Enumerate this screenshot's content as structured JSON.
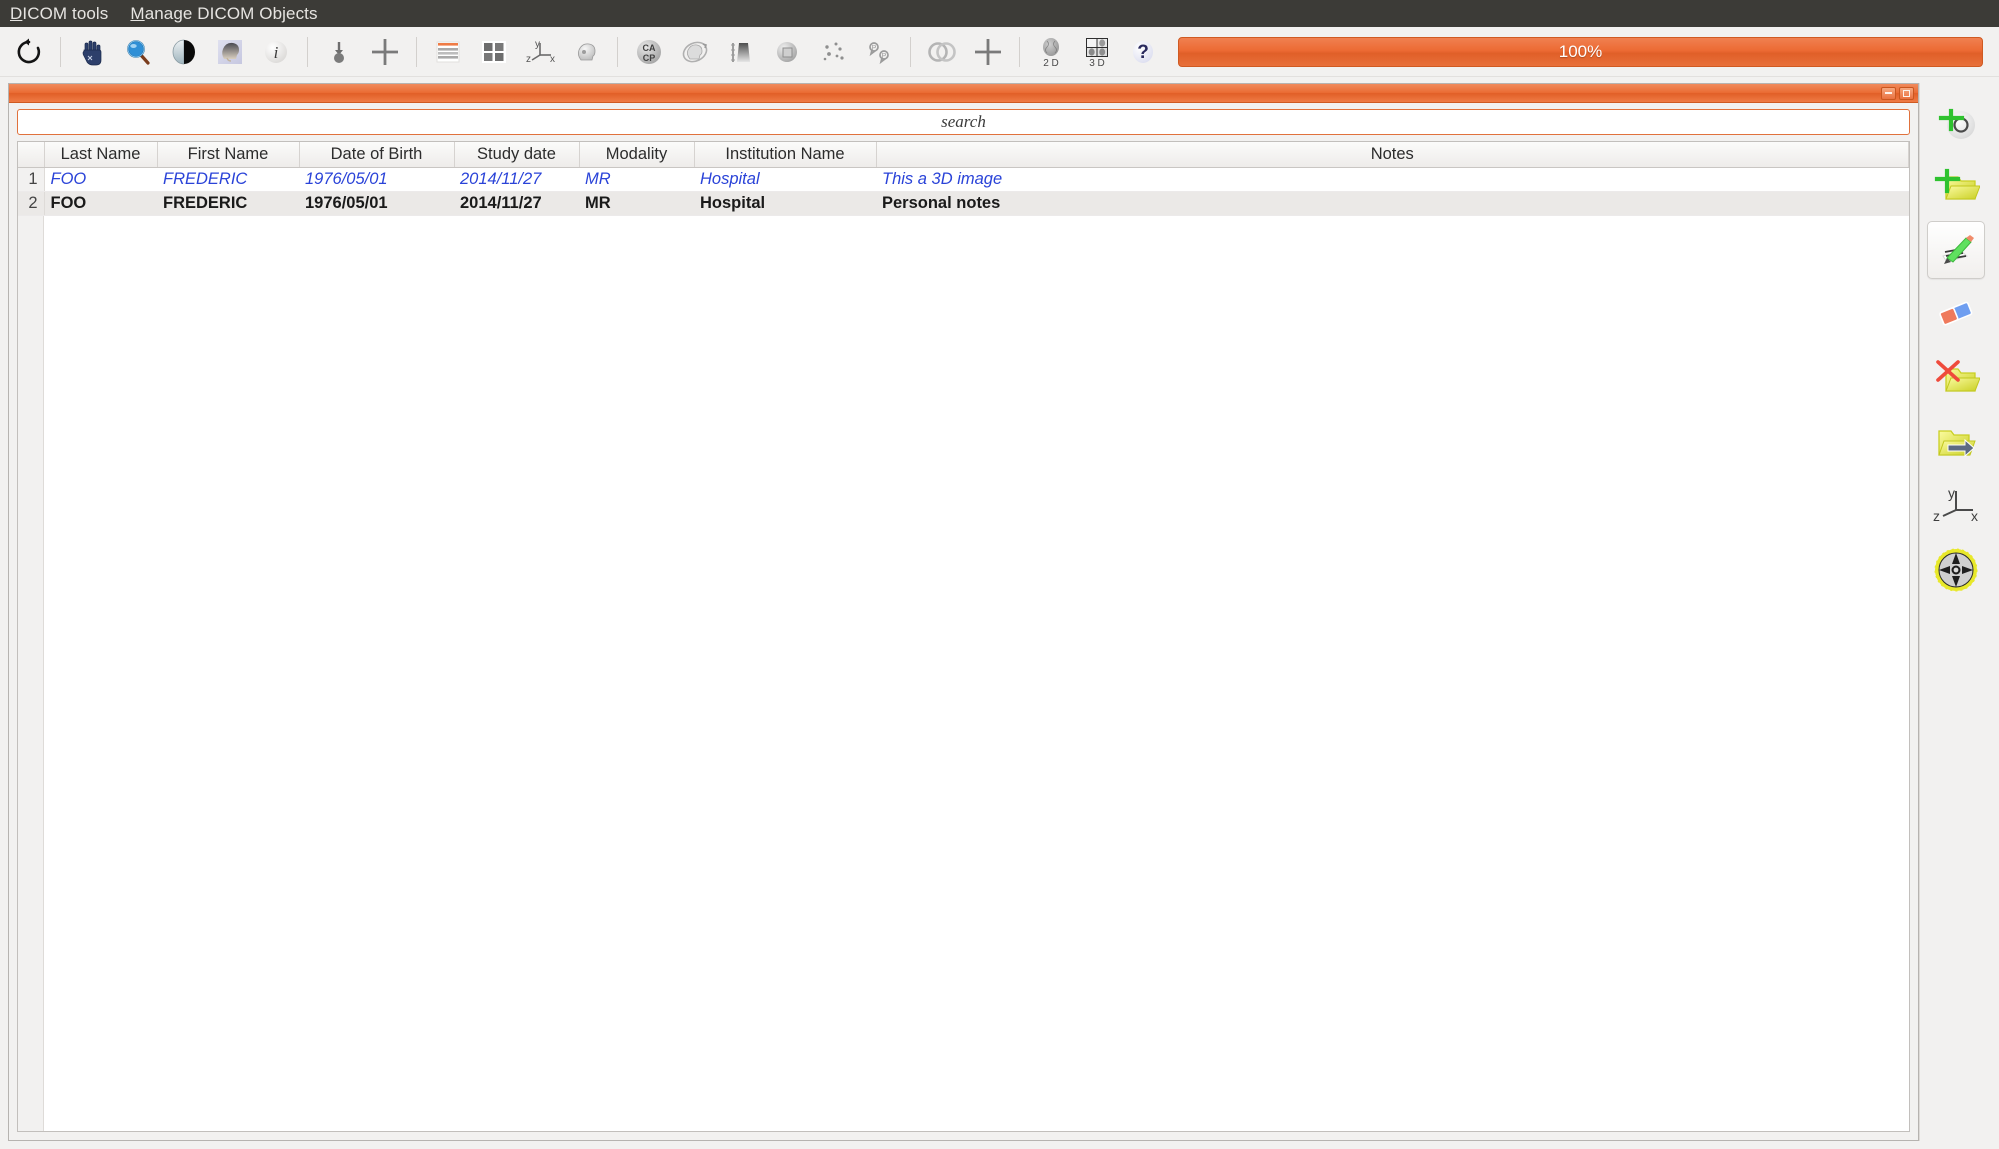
{
  "menubar": {
    "items": [
      {
        "label": "DICOM tools",
        "mnemonic": "D"
      },
      {
        "label": "Manage DICOM Objects",
        "mnemonic": "M"
      }
    ]
  },
  "toolbar": {
    "items": [
      {
        "name": "reset-rotate-icon",
        "label": "Reset"
      },
      {
        "sep": true
      },
      {
        "name": "hand-pan-icon",
        "label": "Pan"
      },
      {
        "name": "magnifier-zoom-icon",
        "label": "Zoom"
      },
      {
        "name": "contrast-windowlevel-icon",
        "label": "Window Level"
      },
      {
        "name": "head-preset-icon",
        "label": "Presets"
      },
      {
        "name": "info-icon",
        "label": "Information"
      },
      {
        "sep": true
      },
      {
        "name": "probe-pin-icon",
        "label": "Probe"
      },
      {
        "name": "crosshair-icon",
        "label": "Crosshair"
      },
      {
        "sep": true
      },
      {
        "name": "layout-rows-icon",
        "label": "Single Layout"
      },
      {
        "name": "layout-grid-icon",
        "label": "Grid Layout"
      },
      {
        "name": "axes-yzx-icon",
        "label": "Axes Orientation"
      },
      {
        "name": "skull-3d-icon",
        "label": "3D View"
      },
      {
        "sep": true
      },
      {
        "name": "ca-cp-icon",
        "label": "CA CP"
      },
      {
        "name": "head-rotate-icon",
        "label": "Rotate Volume"
      },
      {
        "name": "histogram-icon",
        "label": "Histogram"
      },
      {
        "name": "sphere-roi-icon",
        "label": "ROI Sphere"
      },
      {
        "name": "point-cloud-icon",
        "label": "Point Cloud"
      },
      {
        "name": "markers-icon",
        "label": "Markers"
      },
      {
        "sep": true
      },
      {
        "name": "fusion-rings-icon",
        "label": "Fusion"
      },
      {
        "name": "add-cross-icon",
        "label": "Add"
      },
      {
        "sep": true
      },
      {
        "name": "brain-2d-icon",
        "label": "2 D"
      },
      {
        "name": "brain-3d-icon",
        "label": "3 D"
      },
      {
        "name": "help-question-icon",
        "label": "Help"
      }
    ],
    "brain_2d_label": "2 D",
    "brain_3d_label": "3 D",
    "ca_label": "CA",
    "cp_label": "CP",
    "progress": {
      "value": "100%",
      "percent": 100,
      "color": "#e8703a"
    }
  },
  "panel": {
    "window_buttons": [
      {
        "name": "minimize-button",
        "label": "Minimize"
      },
      {
        "name": "restore-button",
        "label": "Restore"
      }
    ],
    "search": {
      "value": "",
      "placeholder": "search"
    },
    "table": {
      "columns": [
        "Last Name",
        "First Name",
        "Date of Birth",
        "Study date",
        "Modality",
        "Institution Name",
        "Notes"
      ],
      "rows": [
        {
          "index": "1",
          "style": "link",
          "cells": [
            "FOO",
            "FREDERIC",
            "1976/05/01",
            "2014/11/27",
            "MR",
            "Hospital",
            "This a 3D image"
          ]
        },
        {
          "index": "2",
          "style": "selected",
          "cells": [
            "FOO",
            "FREDERIC",
            "1976/05/01",
            "2014/11/27",
            "MR",
            "Hospital",
            "Personal notes"
          ]
        }
      ]
    }
  },
  "sidebar": {
    "items": [
      {
        "name": "add-point-button",
        "label": "Add point",
        "active": false
      },
      {
        "name": "new-folder-button",
        "label": "New folder",
        "active": false
      },
      {
        "name": "edit-notes-button",
        "label": "Edit notes",
        "active": true
      },
      {
        "name": "eraser-button",
        "label": "Erase",
        "active": false
      },
      {
        "name": "delete-folder-button",
        "label": "Delete folder",
        "active": false
      },
      {
        "name": "export-folder-button",
        "label": "Export folder",
        "active": false
      },
      {
        "name": "axes-orientation-button",
        "label": "Axes orientation",
        "active": false
      },
      {
        "name": "settings-gear-button",
        "label": "Settings",
        "active": false
      }
    ],
    "axes_labels": {
      "y": "y",
      "z": "z",
      "x": "x"
    }
  },
  "colors": {
    "accent": "#e8703a",
    "menubar_bg": "#3c3b37",
    "link_row": "#2a43d8",
    "panel_bg": "#f2f1f0"
  }
}
